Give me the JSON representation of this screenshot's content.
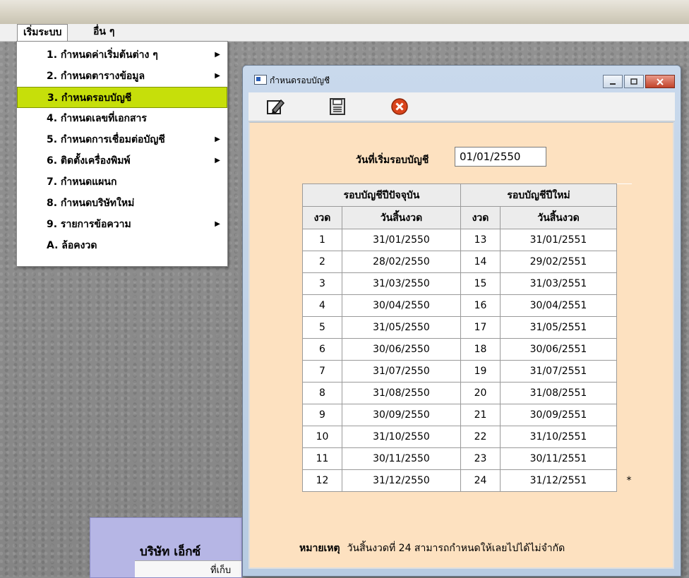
{
  "menubar": {
    "items": [
      "เริ่มระบบ",
      "อื่น ๆ"
    ]
  },
  "popup_menu": {
    "items": [
      {
        "label": "1. กำหนดค่าเริ่มต้นต่าง ๆ",
        "submenu": true,
        "selected": false
      },
      {
        "label": "2. กำหนดตารางข้อมูล",
        "submenu": true,
        "selected": false
      },
      {
        "label": "3. กำหนดรอบบัญชี",
        "submenu": false,
        "selected": true
      },
      {
        "label": "4. กำหนดเลขที่เอกสาร",
        "submenu": false,
        "selected": false
      },
      {
        "label": "5. กำหนดการเชื่อมต่อบัญชี",
        "submenu": true,
        "selected": false
      },
      {
        "label": "6. ติดตั้งเครื่องพิมพ์",
        "submenu": true,
        "selected": false
      },
      {
        "label": "7. กำหนดแผนก",
        "submenu": false,
        "selected": false
      },
      {
        "label": "8. กำหนดบริษัทใหม่",
        "submenu": false,
        "selected": false
      },
      {
        "label": "9. รายการข้อความ",
        "submenu": true,
        "selected": false
      },
      {
        "label": "A. ล้อคงวด",
        "submenu": false,
        "selected": false
      }
    ],
    "selected_color": "#c6df0a"
  },
  "window": {
    "title": "กำหนดรอบบัญชี",
    "toolbar": {
      "edit_icon": "edit-pencil-icon",
      "save_icon": "floppy-save-icon",
      "close_icon": "red-close-icon"
    },
    "start_label": "วันที่เริ่มรอบบัญชี",
    "start_value": "01/01/2550",
    "table": {
      "group_current": "รอบบัญชีปีปัจจุบัน",
      "group_next": "รอบบัญชีปีใหม่",
      "col_period": "งวด",
      "col_enddate": "วันสิ้นงวด",
      "rows": [
        {
          "p1": "1",
          "d1": "31/01/2550",
          "p2": "13",
          "d2": "31/01/2551"
        },
        {
          "p1": "2",
          "d1": "28/02/2550",
          "p2": "14",
          "d2": "29/02/2551"
        },
        {
          "p1": "3",
          "d1": "31/03/2550",
          "p2": "15",
          "d2": "31/03/2551"
        },
        {
          "p1": "4",
          "d1": "30/04/2550",
          "p2": "16",
          "d2": "30/04/2551"
        },
        {
          "p1": "5",
          "d1": "31/05/2550",
          "p2": "17",
          "d2": "31/05/2551"
        },
        {
          "p1": "6",
          "d1": "30/06/2550",
          "p2": "18",
          "d2": "30/06/2551"
        },
        {
          "p1": "7",
          "d1": "31/07/2550",
          "p2": "19",
          "d2": "31/07/2551"
        },
        {
          "p1": "8",
          "d1": "31/08/2550",
          "p2": "20",
          "d2": "31/08/2551"
        },
        {
          "p1": "9",
          "d1": "30/09/2550",
          "p2": "21",
          "d2": "30/09/2551"
        },
        {
          "p1": "10",
          "d1": "31/10/2550",
          "p2": "22",
          "d2": "31/10/2551"
        },
        {
          "p1": "11",
          "d1": "30/11/2550",
          "p2": "23",
          "d2": "30/11/2551"
        },
        {
          "p1": "12",
          "d1": "31/12/2550",
          "p2": "24",
          "d2": "31/12/2551",
          "mark": "*"
        }
      ]
    },
    "note_label": "หมายเหตุ",
    "note_text": "วันสิ้นงวดที่ 24 สามารถกำหนดให้เลยไปได้ไม่จำกัด",
    "client_bg": "#fde1c0"
  },
  "background_panel": {
    "company_name": "บริษัท เอ็กซ์",
    "address_label": "ที่เก็บ"
  }
}
